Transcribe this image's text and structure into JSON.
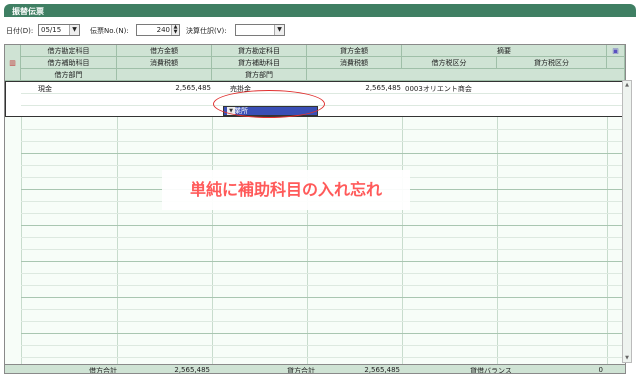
{
  "window": {
    "title": "振替伝票"
  },
  "toolbar": {
    "date_label": "日付(D):",
    "date_value": "05/15",
    "voucher_label": "伝票No.(N):",
    "voucher_value": "240",
    "settlement_label": "決算仕訳(V):",
    "settlement_value": ""
  },
  "grid": {
    "header_row1": [
      "借方勘定科目",
      "借方金額",
      "貸方勘定科目",
      "貸方金額",
      "摘要"
    ],
    "header_row2": [
      "借方補助科目",
      "消費税額",
      "貸方補助科目",
      "消費税額",
      "借方税区分",
      "貸方税区分"
    ],
    "header_row3": [
      "借方部門",
      "貸方部門"
    ],
    "entry": {
      "debit_account": "現金",
      "debit_amount": "2,565,485",
      "credit_account": "売掛金",
      "credit_amount": "2,565,485",
      "description": "0003オリエント商会",
      "credit_sub_dropdown": "事業所"
    },
    "footer": {
      "debit_total_label": "借方合計",
      "debit_total_value": "2,565,485",
      "credit_total_label": "貸方合計",
      "credit_total_value": "2,565,485",
      "balance_label": "貸借バランス",
      "balance_value": "0"
    }
  },
  "annotation": {
    "text": "単純に補助科目の入れ忘れ"
  },
  "icons": {
    "grid_corner": "grid-icon",
    "memo": "note-icon"
  },
  "colors": {
    "title_bar": "#3f7f63",
    "annotation": "#ff5a5a",
    "highlight": "#e0302f",
    "selection": "#3a4fb6"
  }
}
